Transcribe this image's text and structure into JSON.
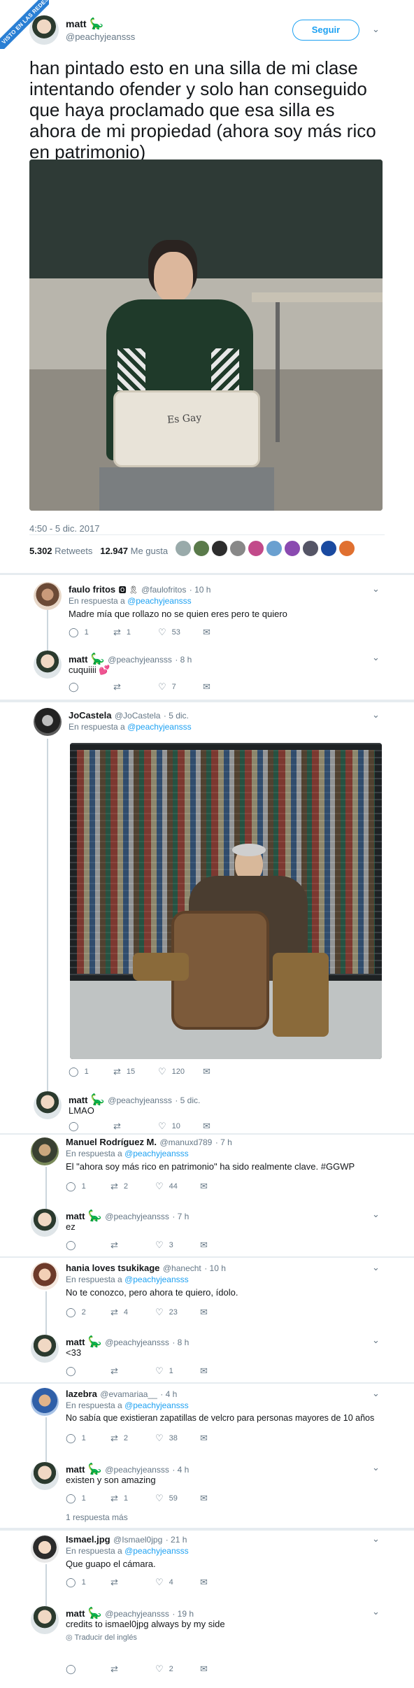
{
  "watermark": "VISTO EN LAS REDES",
  "main": {
    "name": "matt",
    "handle": "@peachyjeansss",
    "follow": "Seguir",
    "text": "han pintado esto en una silla de mi clase intentando ofender y solo han conseguido que haya proclamado que esa silla es ahora de mi propiedad (ahora soy más rico en patrimonio)",
    "chair_text": "Es Gay",
    "time": "4:50 - 5 dic. 2017",
    "retweets_n": "5.302",
    "retweets_l": "Retweets",
    "likes_n": "12.947",
    "likes_l": "Me gusta"
  },
  "colors": {
    "accent": "#1da1f2",
    "like": "#e0245e",
    "dino": "#17bf63"
  },
  "replies": [
    {
      "name": "faulo fritos",
      "badges": "🅾 🎗",
      "handle": "@faulofritos",
      "time": "· 10 h",
      "to": "En respuesta a",
      "to_h": "@peachyjeansss",
      "text": "Madre mía que rollazo no se quien eres pero te quiero",
      "c": "1",
      "r": "1",
      "l": "53"
    },
    {
      "name": "matt",
      "handle": "@peachyjeansss",
      "time": "· 8 h",
      "text": "cuquiiii 💕",
      "c": "",
      "r": "",
      "l": "7"
    },
    {
      "name": "JoCastela",
      "handle": "@JoCastela",
      "time": "· 5 dic.",
      "to": "En respuesta a",
      "to_h": "@peachyjeansss",
      "text": "",
      "c": "1",
      "r": "15",
      "l": "120"
    },
    {
      "name": "matt",
      "handle": "@peachyjeansss",
      "time": "· 5 dic.",
      "text": "LMAO",
      "c": "",
      "r": "",
      "l": "10"
    },
    {
      "name": "Manuel Rodríguez M.",
      "handle": "@manuxd789",
      "time": "· 7 h",
      "to": "En respuesta a",
      "to_h": "@peachyjeansss",
      "text": "El \"ahora soy más rico en patrimonio\" ha sido realmente clave. #GGWP",
      "c": "1",
      "r": "2",
      "l": "44"
    },
    {
      "name": "matt",
      "handle": "@peachyjeansss",
      "time": "· 7 h",
      "text": "ez",
      "c": "",
      "r": "",
      "l": "3"
    },
    {
      "name": "hania loves tsukikage",
      "handle": "@hanecht",
      "time": "· 10 h",
      "to": "En respuesta a",
      "to_h": "@peachyjeansss",
      "text": "No te conozco, pero ahora te quiero, ídolo.",
      "c": "2",
      "r": "4",
      "l": "23"
    },
    {
      "name": "matt",
      "handle": "@peachyjeansss",
      "time": "· 8 h",
      "text": "<33",
      "c": "",
      "r": "",
      "l": "1"
    },
    {
      "name": "lazebra",
      "handle": "@evamariaa__",
      "time": "· 4 h",
      "to": "En respuesta a",
      "to_h": "@peachyjeansss",
      "text": "No sabía que existieran zapatillas de velcro para personas mayores de 10 años",
      "c": "1",
      "r": "2",
      "l": "38"
    },
    {
      "name": "matt",
      "handle": "@peachyjeansss",
      "time": "· 4 h",
      "text": "existen y son amazing",
      "c": "1",
      "r": "1",
      "l": "59"
    },
    {
      "name": "Ismael.jpg",
      "handle": "@Ismael0jpg",
      "time": "· 21 h",
      "to": "En respuesta a",
      "to_h": "@peachyjeansss",
      "text": "Que guapo el cámara.",
      "c": "1",
      "r": "",
      "l": "4"
    },
    {
      "name": "matt",
      "handle": "@peachyjeansss",
      "time": "· 19 h",
      "text": "credits to ismael0jpg always by my side",
      "c": "",
      "r": "",
      "l": "2"
    }
  ],
  "more_replies": "1 respuesta más",
  "translate": "Traducir del inglés",
  "glyphs": {
    "comment": "◯",
    "retweet": "⇄",
    "like": "♡",
    "mail": "✉",
    "chevron": "⌄",
    "dino": "🦕",
    "globe": "◎"
  }
}
